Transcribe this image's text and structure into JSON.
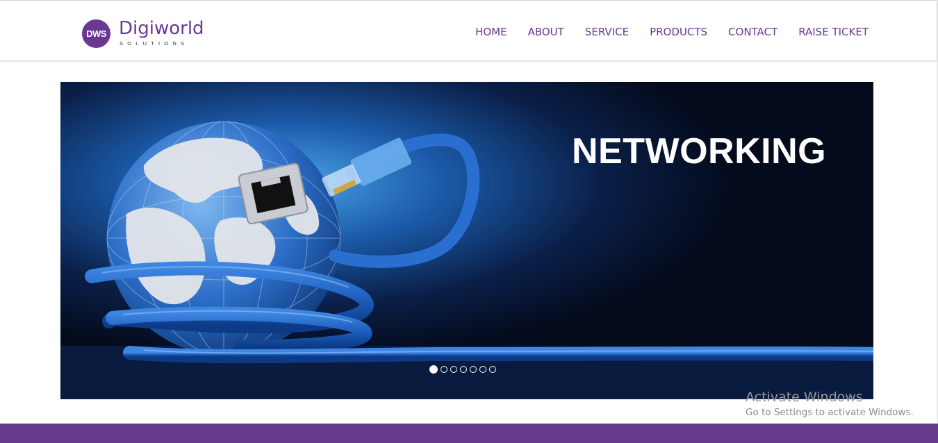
{
  "brand": {
    "badge": "DWS",
    "name": "Digiworld",
    "tagline": "SOLUTIONS",
    "color": "#6a3791"
  },
  "nav": {
    "items": [
      "HOME",
      "ABOUT",
      "SERVICE",
      "PRODUCTS",
      "CONTACT",
      "RAISE TICKET"
    ]
  },
  "slider": {
    "title": "NETWORKING",
    "slide_count": 7,
    "active_slide": 1
  },
  "watermark": {
    "line1": "Activate Windows",
    "line2": "Go to Settings to activate Windows."
  },
  "colors": {
    "footer_bar": "#673b8c",
    "slide_background": "#040b1c",
    "cable_blue": "#1e5fc0"
  }
}
